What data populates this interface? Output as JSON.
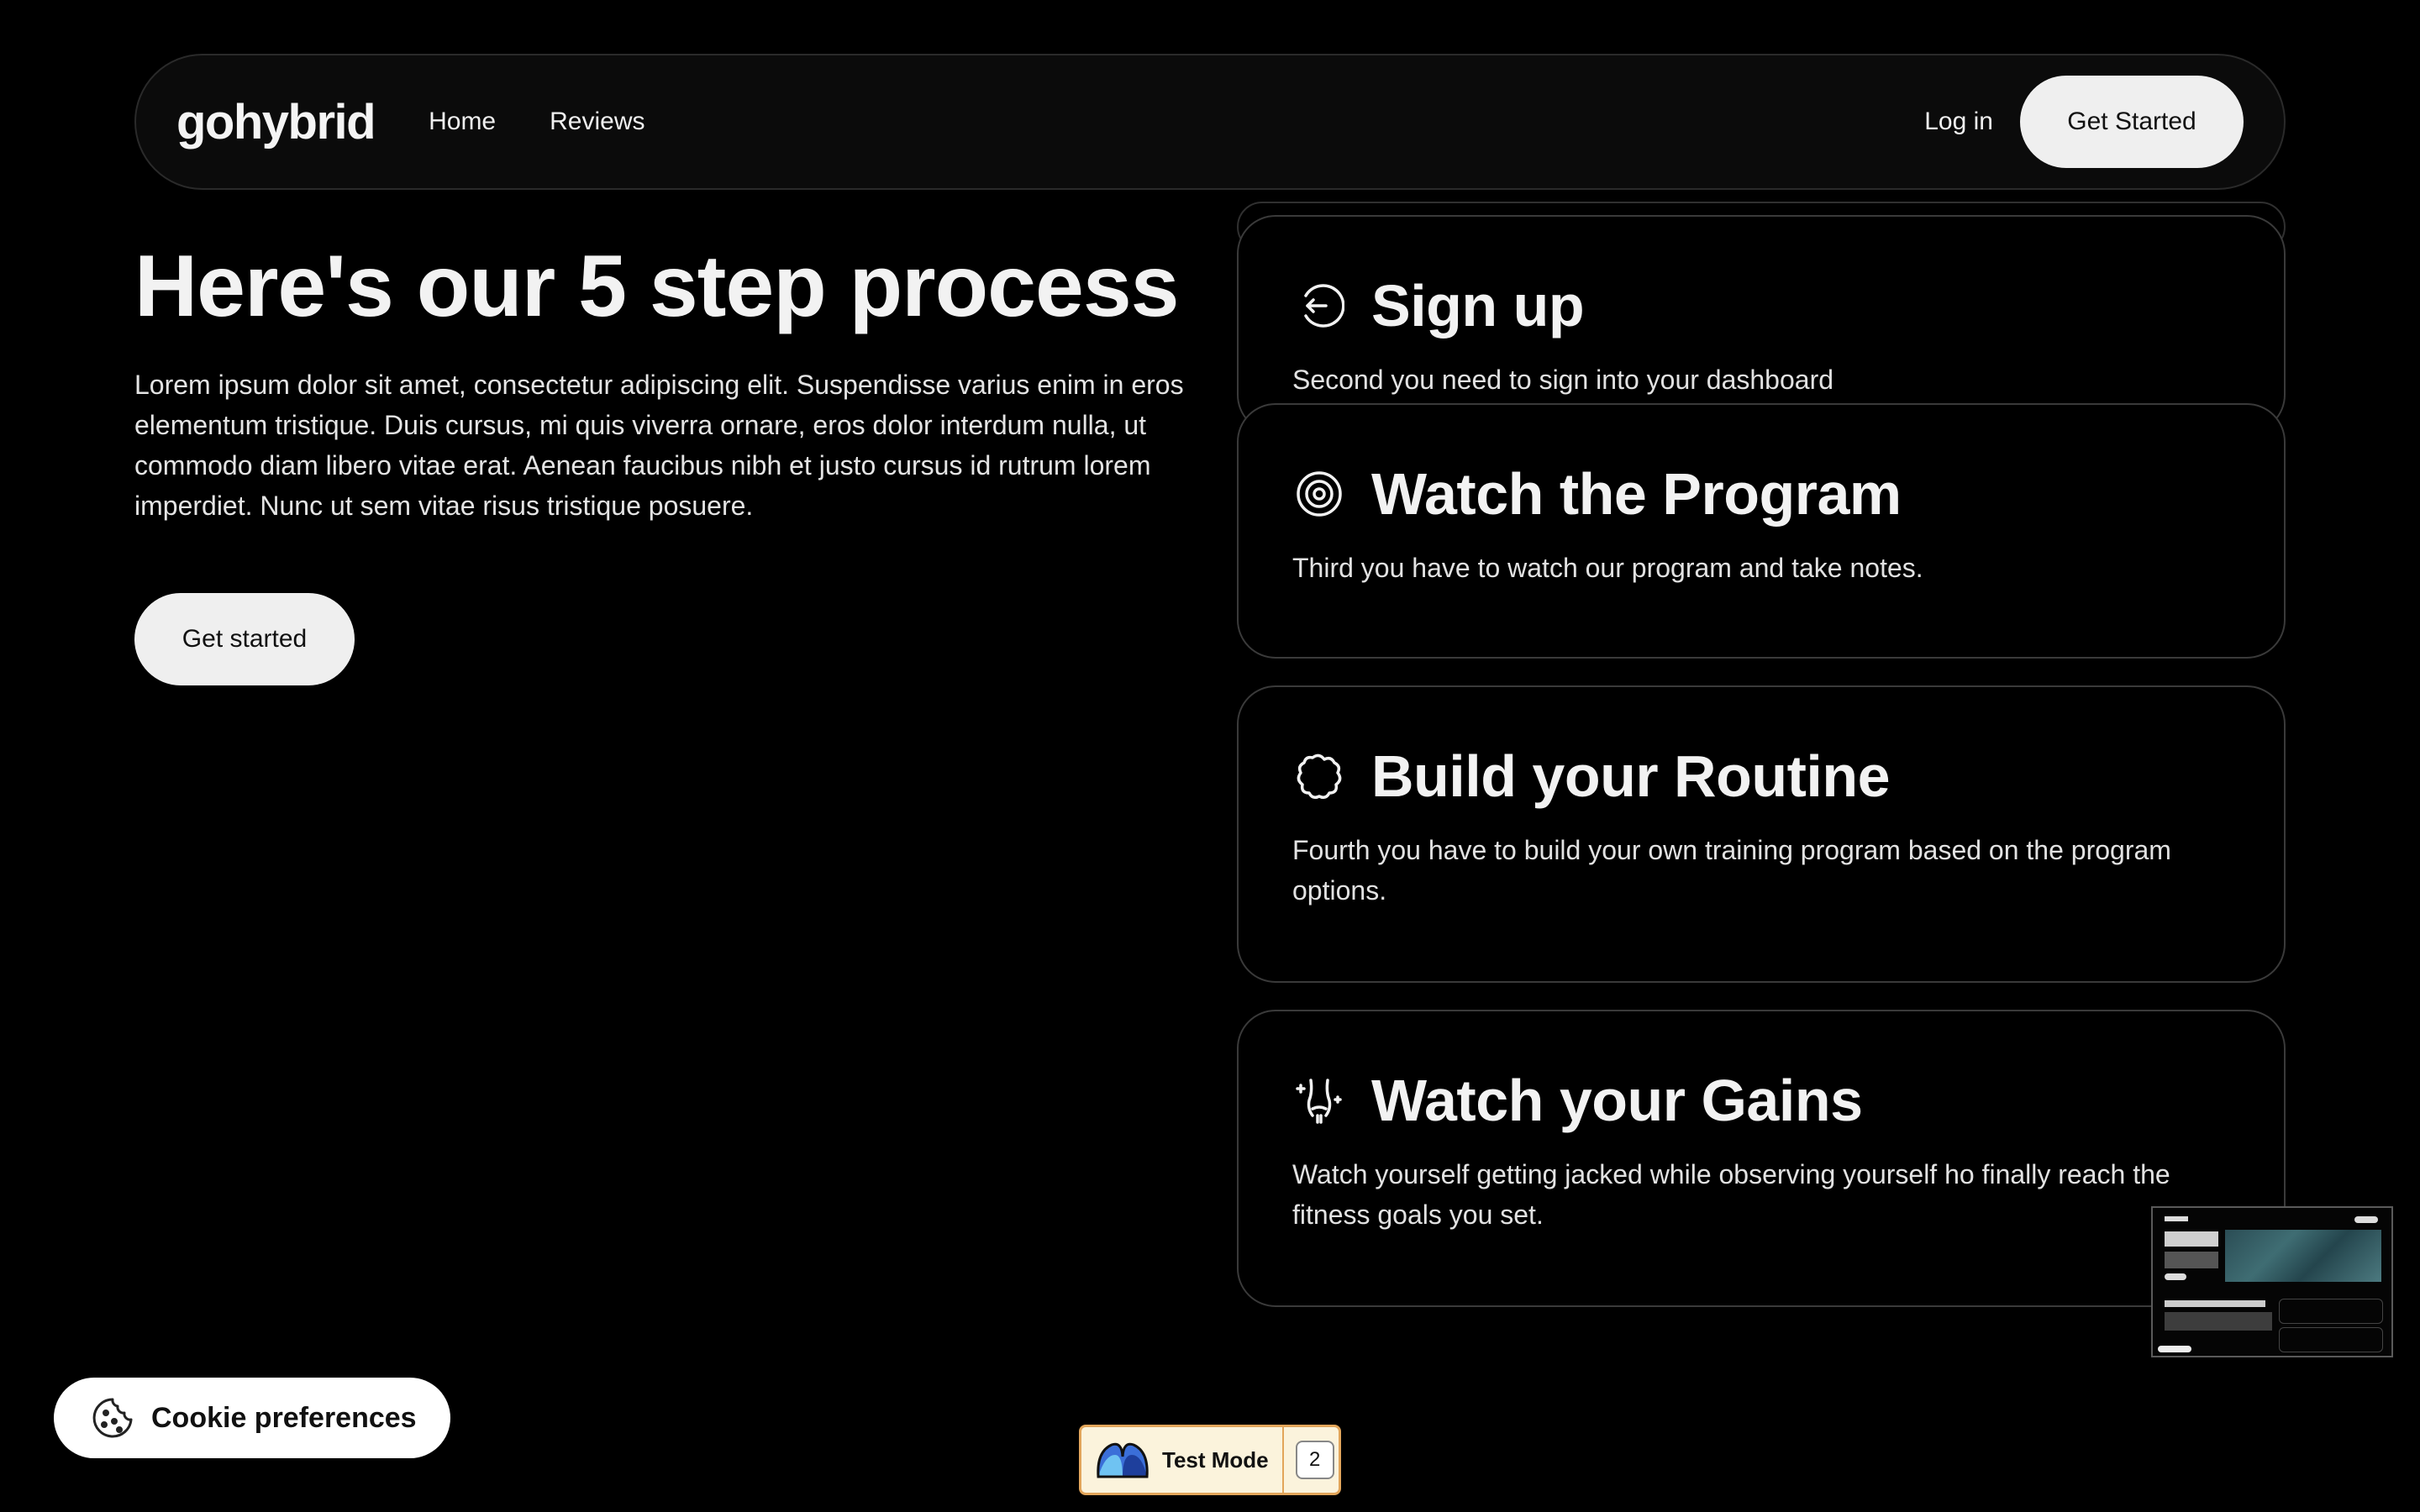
{
  "nav": {
    "logo": "gohybrid",
    "links": [
      "Home",
      "Reviews"
    ],
    "login": "Log in",
    "cta": "Get Started"
  },
  "hero": {
    "title": "Here's our 5 step process",
    "description": "Lorem ipsum dolor sit amet, consectetur adipiscing elit. Suspendisse varius enim in eros elementum tristique. Duis cursus, mi quis viverra ornare, eros dolor interdum nulla, ut commodo diam libero vitae erat. Aenean faucibus nibh et justo cursus id rutrum lorem imperdiet. Nunc ut sem vitae risus tristique posuere.",
    "cta": "Get started"
  },
  "steps": [
    {
      "icon": "sign-in-icon",
      "title": "Sign up",
      "text": "Second you need to sign into your dashboard"
    },
    {
      "icon": "eye-icon",
      "title": "Watch the Program",
      "text": "Third you have to watch our program and take notes."
    },
    {
      "icon": "puzzle-icon",
      "title": "Build your Routine",
      "text": "Fourth you have to build your own training program based on the program options."
    },
    {
      "icon": "body-icon",
      "title": "Watch your Gains",
      "text": "Watch yourself getting jacked while observing yourself ho finally reach the fitness goals you set."
    }
  ],
  "cookie": {
    "label": "Cookie preferences"
  },
  "test_mode": {
    "label": "Test Mode",
    "count": "2"
  }
}
